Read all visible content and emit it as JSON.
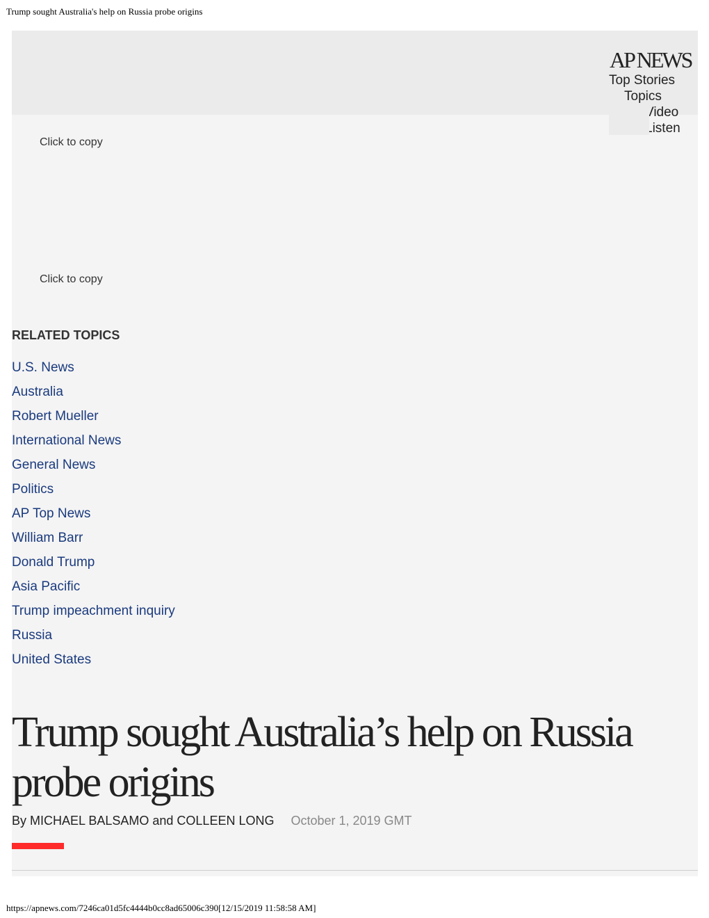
{
  "print_header": "Trump sought Australia's help on Russia probe origins",
  "print_footer": "https://apnews.com/7246ca01d5fc4444b0cc8ad65006c390[12/15/2019 11:58:58 AM]",
  "header": {
    "logo": "AP NEWS",
    "nav": [
      {
        "label": "Top Stories"
      },
      {
        "label": "Topics"
      },
      {
        "label": "Video"
      },
      {
        "label": "Listen"
      }
    ]
  },
  "share": {
    "copy_label_1": "Click to copy",
    "copy_label_2": "Click to copy"
  },
  "related_topics": {
    "title": "RELATED TOPICS",
    "items": [
      {
        "label": "U.S. News"
      },
      {
        "label": "Australia"
      },
      {
        "label": "Robert Mueller"
      },
      {
        "label": "International News"
      },
      {
        "label": "General News"
      },
      {
        "label": "Politics"
      },
      {
        "label": "AP Top News"
      },
      {
        "label": "William Barr"
      },
      {
        "label": "Donald Trump"
      },
      {
        "label": "Asia Pacific"
      },
      {
        "label": "Trump impeachment inquiry"
      },
      {
        "label": "Russia"
      },
      {
        "label": "United States"
      }
    ]
  },
  "article": {
    "headline": "Trump sought Australia’s help on Russia probe origins",
    "byline": "By MICHAEL BALSAMO and COLLEEN LONG",
    "date": "October 1, 2019 GMT"
  },
  "colors": {
    "link": "#1a3a7e",
    "accent_bar": "#ff2a2a",
    "page_bg": "#f4f4f4",
    "header_bg": "#ebebeb"
  }
}
